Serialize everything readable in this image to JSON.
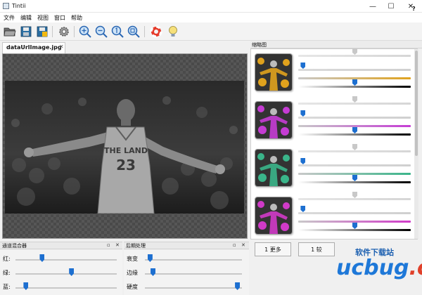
{
  "window": {
    "title": "Tintii",
    "minimize": "—",
    "maximize": "☐",
    "close": "✕"
  },
  "menu": [
    "文件",
    "编辑",
    "视图",
    "窗口",
    "帮助"
  ],
  "toolbar": {
    "help": "?"
  },
  "document": {
    "tab_label": "dataUrlImage.jpg",
    "tab_close": "✕",
    "photo": {
      "jersey_text": "THE LAND",
      "jersey_number": "23"
    }
  },
  "right_panel": {
    "title": "缩略图",
    "thumbs": [
      {
        "name": "thumb-orange",
        "color": "#e0a21d"
      },
      {
        "name": "thumb-magenta",
        "color": "#c53cd4"
      },
      {
        "name": "thumb-green",
        "color": "#3ab58a"
      },
      {
        "name": "thumb-pink",
        "color": "#d03ac8"
      }
    ],
    "more_button": "1 更多",
    "other_button": "1 较"
  },
  "bottom_left_panel": {
    "title": "通道混合器",
    "rows": [
      {
        "label": "红:",
        "value": 0.26
      },
      {
        "label": "绿:",
        "value": 0.55
      },
      {
        "label": "蓝:",
        "value": 0.1
      }
    ]
  },
  "bottom_right_panel": {
    "title": "后期处理",
    "rows": [
      {
        "label": "衰变",
        "value": 0.05
      },
      {
        "label": "边缘",
        "value": 0.08
      },
      {
        "label": "硬度",
        "value": 0.95
      }
    ]
  },
  "watermark": {
    "top_text": "软件下载站",
    "brand_u": "u",
    "brand_rest": "cbug",
    "brand_cc": ".cc"
  }
}
